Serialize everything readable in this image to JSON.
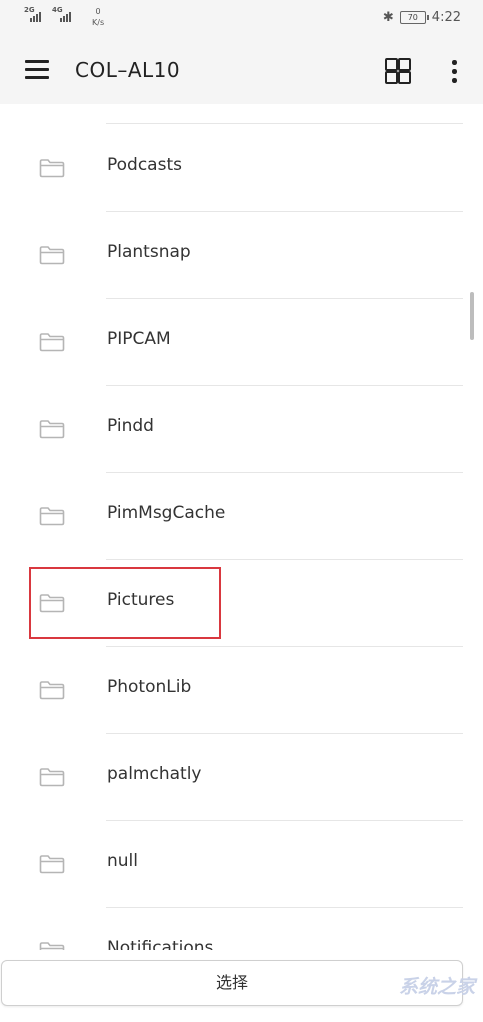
{
  "status_bar": {
    "signal1_label": "2G",
    "signal2_label": "4G",
    "net_speed_value": "0",
    "net_speed_unit": "K/s",
    "battery_level": "70",
    "time": "4:22"
  },
  "app_bar": {
    "title": "COL–AL10"
  },
  "folders": [
    {
      "name": "Podcasts"
    },
    {
      "name": "Plantsnap"
    },
    {
      "name": "PIPCAM"
    },
    {
      "name": "Pindd"
    },
    {
      "name": "PimMsgCache"
    },
    {
      "name": "Pictures"
    },
    {
      "name": "PhotonLib"
    },
    {
      "name": "palmchatly"
    },
    {
      "name": "null"
    },
    {
      "name": "Notifications"
    }
  ],
  "highlighted_folder": "Pictures",
  "colors": {
    "highlight": "#d9383f",
    "folder_icon": "#b5b5b5"
  },
  "bottom_bar": {
    "select_label": "选择"
  },
  "watermark": "系统之家"
}
